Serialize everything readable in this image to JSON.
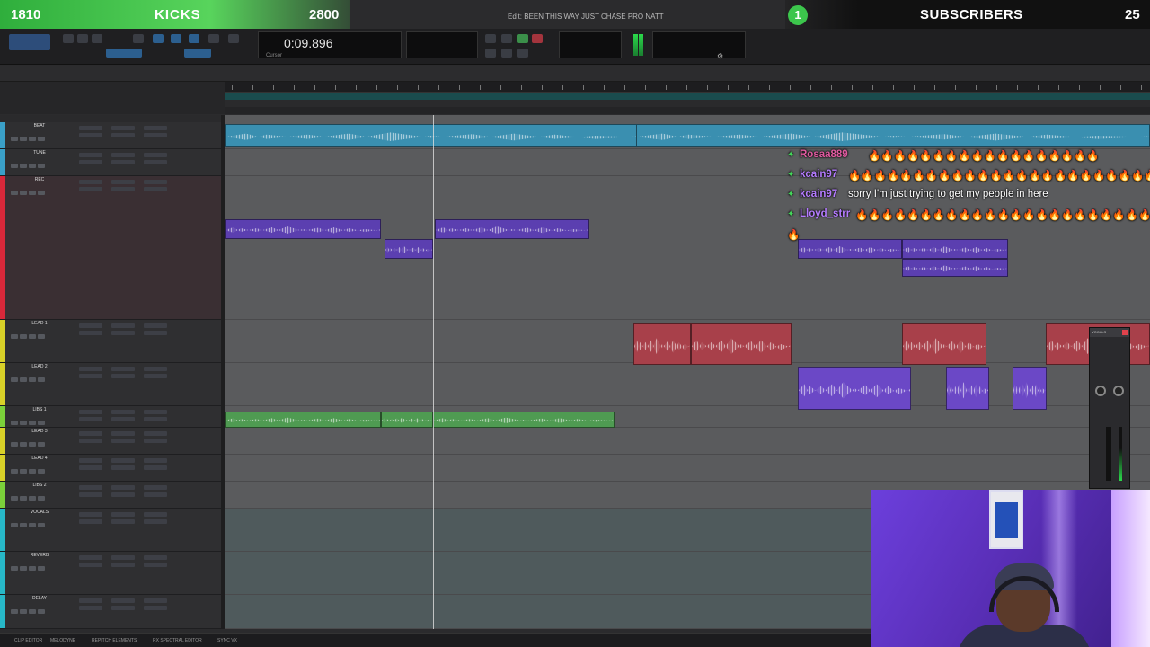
{
  "overlay": {
    "left_count": "1810",
    "left_label": "KICKS",
    "left_goal": "2800",
    "right_badge": "1",
    "right_label": "SUBSCRIBERS",
    "right_count": "25"
  },
  "window": {
    "title": "Edit: BEEN THIS WAY JUST CHASE PRO NATT"
  },
  "transport": {
    "counter_value": "0:09.896",
    "counter_caption": "Cursor"
  },
  "tracks": [
    {
      "name": "BEAT",
      "color": "#3aa0c8"
    },
    {
      "name": "TUNE",
      "color": "#3aa0c8"
    },
    {
      "name": "REC",
      "color": "#d8283a"
    },
    {
      "name": "LEAD 1",
      "color": "#d8d028"
    },
    {
      "name": "LEAD 2",
      "color": "#d8d028"
    },
    {
      "name": "LIBS 1",
      "color": "#7bd03a"
    },
    {
      "name": "LEAD 3",
      "color": "#d8d028"
    },
    {
      "name": "LEAD 4",
      "color": "#d8d028"
    },
    {
      "name": "LIBS 2",
      "color": "#7bd03a"
    },
    {
      "name": "VOCALS",
      "color": "#27b8c8"
    },
    {
      "name": "REVERB",
      "color": "#27b8c8"
    },
    {
      "name": "DELAY",
      "color": "#27b8c8"
    }
  ],
  "chat": [
    {
      "user": "Rosaa889",
      "text": "🔥🔥🔥🔥🔥🔥🔥🔥🔥🔥🔥🔥🔥🔥🔥🔥🔥🔥"
    },
    {
      "user": "kcain97",
      "text": "🔥🔥🔥🔥🔥🔥🔥🔥🔥🔥🔥🔥🔥🔥🔥🔥🔥🔥🔥🔥🔥🔥🔥🔥🔥"
    },
    {
      "user": "kcain97",
      "text": "sorry I'm just trying to get my people in here"
    },
    {
      "user": "Lloyd_strr",
      "text": "🔥🔥🔥🔥🔥🔥🔥🔥🔥🔥🔥🔥🔥🔥🔥🔥🔥🔥🔥🔥🔥🔥🔥🔥🔥🔥"
    }
  ],
  "chat_extra_fire": "🔥",
  "plugin": {
    "title": "VOCALS"
  },
  "statusbar": [
    "CLIP EDITOR",
    "MELODYNE",
    "REPITCH ELEMENTS",
    "RX SPECTRAL EDITOR",
    "SYNC VX"
  ],
  "colors": {
    "kicks_green": "#3fc04d",
    "rec_purple": "#5b3fb0",
    "lead_red": "#a8404a",
    "libs_green": "#4f9b52",
    "beat_blue": "#3a8fb0"
  }
}
